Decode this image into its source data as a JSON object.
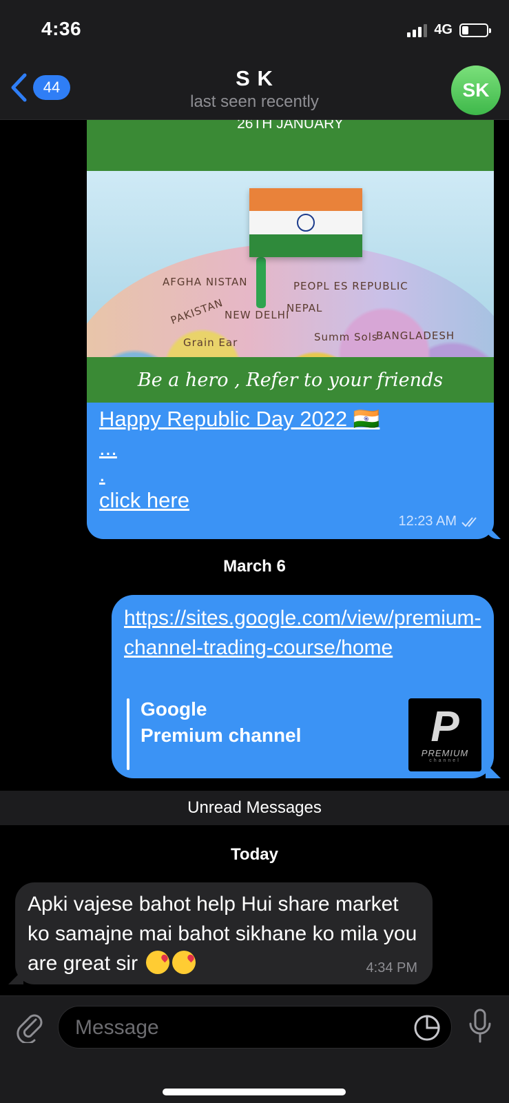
{
  "status": {
    "time": "4:36",
    "network": "4G"
  },
  "header": {
    "back_count": "44",
    "title": "S K",
    "subtitle": "last seen recently",
    "avatar_initials": "SK"
  },
  "image_message": {
    "banner_top": "26TH JANUARY",
    "banner_bottom": "Be a hero , Refer to your friends",
    "map_labels": [
      "AFGHA NISTAN",
      "PAKISTAN",
      "NEW DELHI",
      "PEOPL ES REPUBLIC",
      "NEPAL",
      "Summ Sols",
      "Grain Ear",
      "BANGLADESH"
    ],
    "caption_title": "Happy Republic Day 2022 🇮🇳",
    "caption_ellipsis": "...",
    "caption_dot": ".",
    "caption_link": "click here",
    "time": "12:23 AM"
  },
  "date_sep_1": "March 6",
  "link_message": {
    "url": "https://sites.google.com/view/premium-channel-trading-course/home",
    "preview_site": "Google",
    "preview_title": "Premium channel",
    "thumb_text": "PREMIUM",
    "thumb_subtext": "channel"
  },
  "unread_label": "Unread Messages",
  "date_sep_2": "Today",
  "incoming_message": {
    "text": "Apki vajese bahot help Hui share market ko samajne mai bahot sikhane ko mila you are great sir",
    "time": "4:34 PM"
  },
  "input": {
    "placeholder": "Message"
  },
  "colors": {
    "accent": "#3b93f5",
    "banner_green": "#3a8a35",
    "avatar_green": "#4cc95a"
  }
}
